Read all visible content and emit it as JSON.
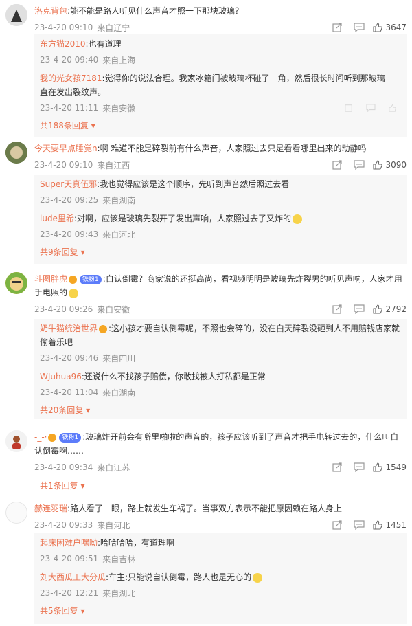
{
  "comments": [
    {
      "user": "洛克背包",
      "text": ":能不能是路人听见什么声音才照一下那块玻璃？",
      "time": "23-4-20 09:10",
      "loc": "来自辽宁",
      "likes": "3647",
      "replies": [
        {
          "user": "东方猫2010",
          "text": ":也有道理",
          "time": "23-4-20 09:40",
          "loc": "来自上海"
        },
        {
          "user": "我的光女孩7181",
          "text": ":觉得你的说法合理。我家冰箱门被玻璃杯碰了一角，然后很长时间听到那玻璃一直在发出裂纹声。",
          "time": "23-4-20 11:11",
          "loc": "来自安徽"
        }
      ],
      "more": "共188条回复"
    },
    {
      "user": "今天要早点睡觉n",
      "text": ":啊 难道不能是碎裂前有什么声音，人家照过去只是看看哪里出来的动静吗",
      "time": "23-4-20 09:10",
      "loc": "来自江西",
      "likes": "3090",
      "replies": [
        {
          "user": "Super天真伍邪",
          "text": ":我也觉得应该是这个顺序，先听到声音然后照过去看",
          "time": "23-4-20 09:25",
          "loc": "来自湖南"
        },
        {
          "user": "lude里希",
          "text": ":对啊，应该是玻璃先裂开了发出声响，人家照过去了又炸的",
          "time": "23-4-20 09:43",
          "loc": "来自河北"
        }
      ],
      "more": "共9条回复"
    },
    {
      "user": "斗图胖虎",
      "badge": "铁粉1",
      "text": ":自认倒霉？商家说的还挺高尚，看视频明明是玻璃先炸裂男的听见声响，人家才用手电照的",
      "time": "23-4-20 09:26",
      "loc": "来自安徽",
      "likes": "2792",
      "replies": [
        {
          "user": "奶牛猫统治世界",
          "text": ":这小孩才要自认倒霉呢，不照也会碎的，没在白天碎裂没砸到人不用赔钱店家就偷着乐吧",
          "time": "23-4-20 09:46",
          "loc": "来自四川"
        },
        {
          "user": "WJuhua96",
          "text": ":还说什么不找孩子赔偿，你敢找被人打私都是正常",
          "time": "23-4-20 11:04",
          "loc": "来自湖南"
        }
      ],
      "more": "共20条回复"
    },
    {
      "user": "-_-·",
      "badge": "铁粉1",
      "text": ":玻璃炸开前会有噼里啪啦的声音的，孩子应该听到了声音才把手电转过去的，什么叫自认倒霉啊……",
      "time": "23-4-20 09:34",
      "loc": "来自江苏",
      "likes": "1549",
      "replies": [],
      "more": "共1条回复"
    },
    {
      "user": "赫连羽瑞",
      "text": ":路人看了一眼，路上就发生车祸了。当事双方表示不能把原因赖在路人身上",
      "time": "23-4-20 09:33",
      "loc": "来自河北",
      "likes": "1451",
      "replies": [
        {
          "user": "起床困难户嘿呦",
          "text": ":哈哈哈哈，有道理啊",
          "time": "23-4-20 09:51",
          "loc": "来自吉林"
        },
        {
          "user": "刘大西瓜工大分瓜",
          "text": ":车主:只能说自认倒霉，路人也是无心的",
          "time": "23-4-20 12:21",
          "loc": "来自湖北"
        }
      ],
      "more": "共5条回复"
    }
  ]
}
